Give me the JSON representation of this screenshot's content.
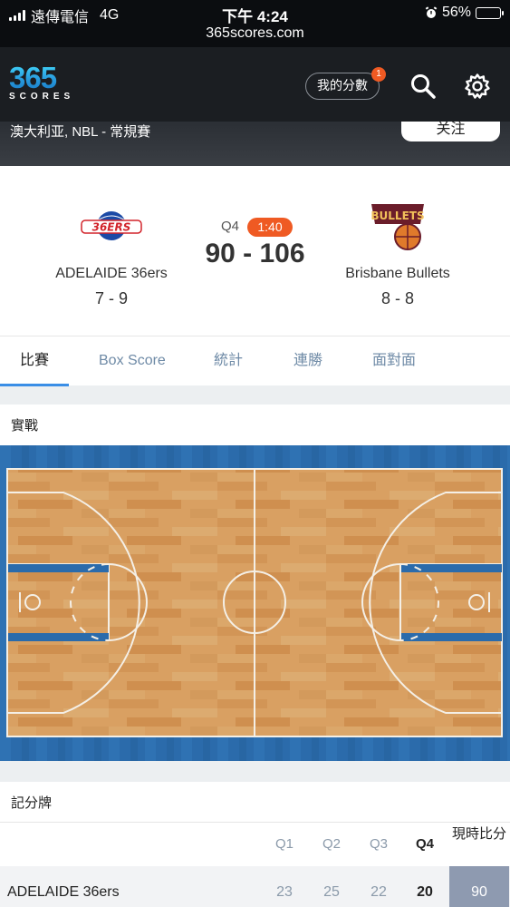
{
  "status_bar": {
    "carrier": "遠傳電信",
    "network": "4G",
    "time": "下午 4:24",
    "battery": "56%",
    "battery_level": 0.56
  },
  "url": "365scores.com",
  "header": {
    "logo_top": "365",
    "logo_bottom": "SCORES",
    "my_scores_label": "我的分數",
    "notification_count": "1",
    "icons": [
      "search-icon",
      "gear-icon"
    ]
  },
  "competition": {
    "name": "澳大利亚, NBL - 常規賽",
    "follow_label": "关注"
  },
  "match": {
    "period": "Q4",
    "clock": "1:40",
    "score": "90 - 106",
    "home": {
      "name": "ADELAIDE 36ers",
      "record": "7 - 9",
      "logo_text": "36ERS"
    },
    "away": {
      "name": "Brisbane Bullets",
      "record": "8 - 8",
      "logo_text": "BULLETS"
    }
  },
  "tabs": [
    {
      "label": "比賽",
      "active": true
    },
    {
      "label": "Box Score",
      "active": false
    },
    {
      "label": "統計",
      "active": false
    },
    {
      "label": "連勝",
      "active": false
    },
    {
      "label": "面對面",
      "active": false
    }
  ],
  "live": {
    "title": "實戰"
  },
  "scoreboard": {
    "title": "記分牌",
    "columns": [
      "Q1",
      "Q2",
      "Q3",
      "Q4",
      "現時比分"
    ],
    "rows": [
      {
        "team": "ADELAIDE 36ers",
        "q1": "23",
        "q2": "25",
        "q3": "22",
        "q4": "20",
        "total": "90"
      }
    ]
  },
  "colors": {
    "accent": "#3a8ee6",
    "live_orange": "#ef5a23",
    "court_blue": "#2b6bab",
    "wood": "#d79a5a"
  }
}
